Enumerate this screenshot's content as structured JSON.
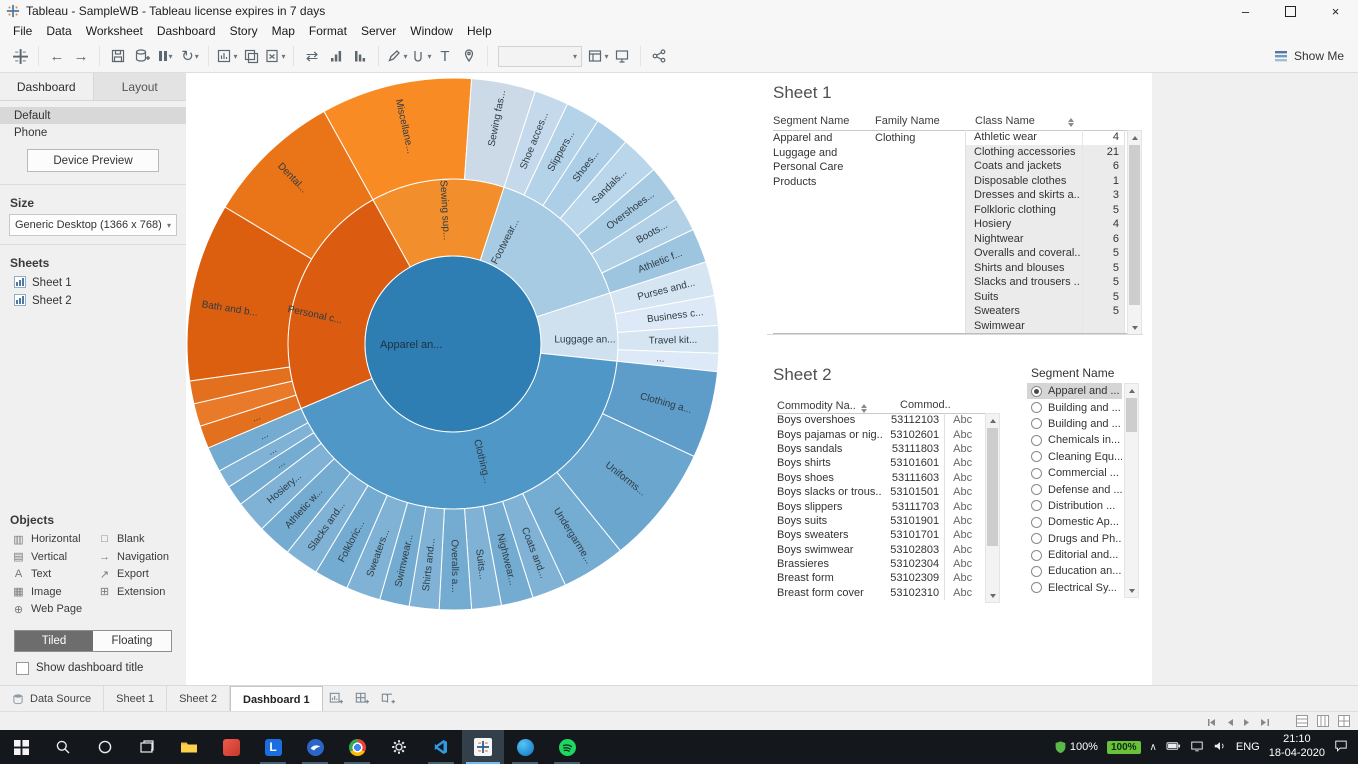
{
  "window": {
    "title": "Tableau - SampleWB - Tableau license expires in 7 days"
  },
  "menus": [
    "File",
    "Data",
    "Worksheet",
    "Dashboard",
    "Story",
    "Map",
    "Format",
    "Server",
    "Window",
    "Help"
  ],
  "toolbar": {
    "show_me": "Show Me"
  },
  "icons": {
    "caret": "▾",
    "minimize": "–",
    "close": "×",
    "back": "←",
    "forward": "→",
    "refresh": "↻",
    "swap": "⇄",
    "text_label": "T",
    "objects_left_icons": [
      "▥",
      "▤",
      "A",
      "▦",
      "⊕"
    ],
    "objects_right_icons": [
      "□",
      "→",
      "↗",
      "⊞"
    ],
    "chevron_up": "∧"
  },
  "panel": {
    "tab_dashboard": "Dashboard",
    "tab_layout": "Layout",
    "devices": [
      "Default",
      "Phone"
    ],
    "device_preview": "Device Preview",
    "size_header": "Size",
    "size_value": "Generic Desktop (1366 x 768)",
    "sheets_header": "Sheets",
    "sheet_items": [
      "Sheet 1",
      "Sheet 2"
    ],
    "objects_header": "Objects",
    "objects_left": [
      "Horizontal",
      "Vertical",
      "Text",
      "Image",
      "Web Page"
    ],
    "objects_right": [
      "Blank",
      "Navigation",
      "Export",
      "Extension"
    ],
    "tiled": "Tiled",
    "floating": "Floating",
    "show_dashboard_title": "Show dashboard title"
  },
  "sheet1": {
    "title": "Sheet 1",
    "col_segment": "Segment Name",
    "col_family": "Family Name",
    "col_class": "Class Name",
    "segment_lines": [
      "Apparel and",
      "Luggage and",
      "Personal Care",
      "Products"
    ],
    "family": "Clothing",
    "rows": [
      {
        "class": "Athletic wear",
        "value": "4"
      },
      {
        "class": "Clothing accessories",
        "value": "21"
      },
      {
        "class": "Coats and jackets",
        "value": "6"
      },
      {
        "class": "Disposable clothes",
        "value": "1"
      },
      {
        "class": "Dresses and skirts a..",
        "value": "3"
      },
      {
        "class": "Folkloric clothing",
        "value": "5"
      },
      {
        "class": "Hosiery",
        "value": "4"
      },
      {
        "class": "Nightwear",
        "value": "6"
      },
      {
        "class": "Overalls and coveral..",
        "value": "5"
      },
      {
        "class": "Shirts and blouses",
        "value": "5"
      },
      {
        "class": "Slacks and trousers ..",
        "value": "5"
      },
      {
        "class": "Suits",
        "value": "5"
      },
      {
        "class": "Sweaters",
        "value": "5"
      },
      {
        "class": "Swimwear",
        "value": ""
      }
    ]
  },
  "sheet2": {
    "title": "Sheet 2",
    "col_commodity": "Commodity Na..",
    "col_code": "Commod..",
    "rows": [
      {
        "name": "Boys overshoes",
        "code": "53112103",
        "abc": "Abc"
      },
      {
        "name": "Boys pajamas or nig..",
        "code": "53102601",
        "abc": "Abc"
      },
      {
        "name": "Boys sandals",
        "code": "53111803",
        "abc": "Abc"
      },
      {
        "name": "Boys shirts",
        "code": "53101601",
        "abc": "Abc"
      },
      {
        "name": "Boys shoes",
        "code": "53111603",
        "abc": "Abc"
      },
      {
        "name": "Boys slacks or trous..",
        "code": "53101501",
        "abc": "Abc"
      },
      {
        "name": "Boys slippers",
        "code": "53111703",
        "abc": "Abc"
      },
      {
        "name": "Boys suits",
        "code": "53101901",
        "abc": "Abc"
      },
      {
        "name": "Boys sweaters",
        "code": "53101701",
        "abc": "Abc"
      },
      {
        "name": "Boys swimwear",
        "code": "53102803",
        "abc": "Abc"
      },
      {
        "name": "Brassieres",
        "code": "53102304",
        "abc": "Abc"
      },
      {
        "name": "Breast form",
        "code": "53102309",
        "abc": "Abc"
      },
      {
        "name": "Breast form cover",
        "code": "53102310",
        "abc": "Abc"
      }
    ]
  },
  "filter": {
    "title": "Segment Name",
    "items": [
      {
        "label": "Apparel and ...",
        "selected": true
      },
      {
        "label": "Building and ...",
        "selected": false
      },
      {
        "label": "Building and ...",
        "selected": false
      },
      {
        "label": "Chemicals in...",
        "selected": false
      },
      {
        "label": "Cleaning Equ...",
        "selected": false
      },
      {
        "label": "Commercial ...",
        "selected": false
      },
      {
        "label": "Defense and ...",
        "selected": false
      },
      {
        "label": "Distribution ...",
        "selected": false
      },
      {
        "label": "Domestic Ap...",
        "selected": false
      },
      {
        "label": "Drugs and Ph...",
        "selected": false
      },
      {
        "label": "Editorial and...",
        "selected": false
      },
      {
        "label": "Education an...",
        "selected": false
      },
      {
        "label": "Electrical Sy...",
        "selected": false
      }
    ]
  },
  "tabs": {
    "data_source": "Data Source",
    "items": [
      {
        "label": "Sheet 1",
        "active": false
      },
      {
        "label": "Sheet 2",
        "active": false
      },
      {
        "label": "Dashboard 1",
        "active": true
      }
    ]
  },
  "taskbar": {
    "tray_percent1": "100%",
    "tray_percent2": "100%",
    "lang": "ENG",
    "time": "21:10",
    "date": "18-04-2020"
  },
  "chart_data": {
    "type": "sunburst",
    "title": "Product segment sunburst (Segment > Family > Class)",
    "legend": "none",
    "center": {
      "label": "Apparel an...",
      "color": "#2e7db3",
      "radius": 88
    },
    "radii": {
      "r1_inner": 88,
      "r1_outer": 165,
      "r2_outer": 266
    },
    "rings": [
      {
        "name": "family",
        "segments": [
          {
            "label": "Footwear...",
            "start": 18,
            "end": 72,
            "color": "#a6cbe3",
            "label_r": 115,
            "label_angle": 27
          },
          {
            "label": "Luggage an...",
            "start": 72,
            "end": 96,
            "color": "#cfe0ef",
            "label_r": 132,
            "label_angle": 88,
            "horizontal": true
          },
          {
            "label": "Clothing...",
            "start": 96,
            "end": 247,
            "color": "#4f97c6",
            "label_r": 121,
            "label_angle": 166
          },
          {
            "label": "Personal c...",
            "start": 247,
            "end": 331,
            "color": "#db5c10",
            "label_r": 141,
            "label_angle": 282
          },
          {
            "label": "Sewing sup...",
            "start": 331,
            "end": 378,
            "color": "#f28e2b",
            "label_r": 134,
            "label_angle": 356.6
          }
        ]
      },
      {
        "name": "class",
        "segments": [
          {
            "label": "Shoe acces...",
            "start": 18,
            "end": 25.5,
            "color": "#c4daec",
            "label_r": 219
          },
          {
            "label": "Slippers...",
            "start": 25.5,
            "end": 33,
            "color": "#b4d2e8",
            "label_r": 221
          },
          {
            "label": "Shoes...",
            "start": 33,
            "end": 40.5,
            "color": "#accee6",
            "label_r": 222
          },
          {
            "label": "Sandals...",
            "start": 40.5,
            "end": 49,
            "color": "#bad6ea",
            "label_r": 222
          },
          {
            "label": "Overshoes...",
            "start": 49,
            "end": 57,
            "color": "#a8cbe4",
            "label_r": 222
          },
          {
            "label": "Boots...",
            "start": 57,
            "end": 64.5,
            "color": "#b2d1e7",
            "label_r": 228
          },
          {
            "label": "Athletic f...",
            "start": 64.5,
            "end": 72,
            "color": "#9dc5e0",
            "label_r": 223
          },
          {
            "label": "Purses and...",
            "start": 72,
            "end": 79.5,
            "color": "#d5e5f2",
            "label_r": 220
          },
          {
            "label": "Business c...",
            "start": 79.5,
            "end": 86,
            "color": "#dde9f6",
            "label_r": 224
          },
          {
            "label": "Travel kit...",
            "start": 86,
            "end": 92,
            "color": "#d5e5f2",
            "label_r": 220
          },
          {
            "label": "...",
            "start": 92,
            "end": 96,
            "color": "#dde9f6",
            "label_r": 208
          },
          {
            "label": "Clothing a...",
            "start": 96,
            "end": 115,
            "color": "#5e9dc9",
            "label_r": 221
          },
          {
            "label": "Uniforms...",
            "start": 115,
            "end": 141,
            "color": "#6aa6ce",
            "label_r": 219
          },
          {
            "label": "Undergarme...",
            "start": 141,
            "end": 155,
            "color": "#75acd2",
            "label_r": 226
          },
          {
            "label": "Coats and...",
            "start": 155,
            "end": 162.5,
            "color": "#7fb2d5",
            "label_r": 224
          },
          {
            "label": "Nightwear...",
            "start": 162.5,
            "end": 169.5,
            "color": "#74abd1",
            "label_r": 222
          },
          {
            "label": "Suits...",
            "start": 169.5,
            "end": 176,
            "color": "#7fb2d5",
            "label_r": 222
          },
          {
            "label": "Overalls a...",
            "start": 176,
            "end": 183,
            "color": "#74abd1",
            "label_r": 222
          },
          {
            "label": "Shirts and...",
            "start": 183,
            "end": 189.5,
            "color": "#7fb2d5",
            "label_r": 222
          },
          {
            "label": "Swimwear...",
            "start": 189.5,
            "end": 196,
            "color": "#74abd1",
            "label_r": 222
          },
          {
            "label": "Sweaters...",
            "start": 196,
            "end": 203.5,
            "color": "#7fb2d5",
            "label_r": 222
          },
          {
            "label": "Folkloric...",
            "start": 203.5,
            "end": 211,
            "color": "#74abd1",
            "label_r": 222
          },
          {
            "label": "Slacks and...",
            "start": 211,
            "end": 218.5,
            "color": "#7fb2d5",
            "label_r": 222
          },
          {
            "label": "Athletic w...",
            "start": 218.5,
            "end": 226,
            "color": "#74abd1",
            "label_r": 222
          },
          {
            "label": "Hosiery...",
            "start": 226,
            "end": 233,
            "color": "#7fb2d5",
            "label_r": 222
          },
          {
            "label": "...",
            "start": 233,
            "end": 237.5,
            "color": "#74abd1",
            "label_r": 210
          },
          {
            "label": "...",
            "start": 237.5,
            "end": 241.5,
            "color": "#7fb2d5",
            "label_r": 210
          },
          {
            "label": "...",
            "start": 241.5,
            "end": 247,
            "color": "#74abd1",
            "label_r": 210
          },
          {
            "label": "...",
            "start": 247,
            "end": 252,
            "color": "#e2701e",
            "label_r": 210
          },
          {
            "label": "",
            "start": 252,
            "end": 257,
            "color": "#e87a2a",
            "label_r": 210
          },
          {
            "label": "",
            "start": 257,
            "end": 262,
            "color": "#e2701e",
            "label_r": 210
          },
          {
            "label": "Bath and b...",
            "start": 262,
            "end": 301,
            "color": "#dc5f10",
            "label_r": 226,
            "label_angle": 279
          },
          {
            "label": "Dental...",
            "start": 301,
            "end": 331,
            "color": "#ea7418",
            "label_r": 231
          },
          {
            "label": "Miscellane...",
            "start": 331,
            "end": 364,
            "color": "#f98b25",
            "label_r": 223
          },
          {
            "label": "Sewing fas...",
            "start": 364,
            "end": 378,
            "color": "#ccd9e6",
            "label_r": 230
          }
        ]
      }
    ]
  }
}
